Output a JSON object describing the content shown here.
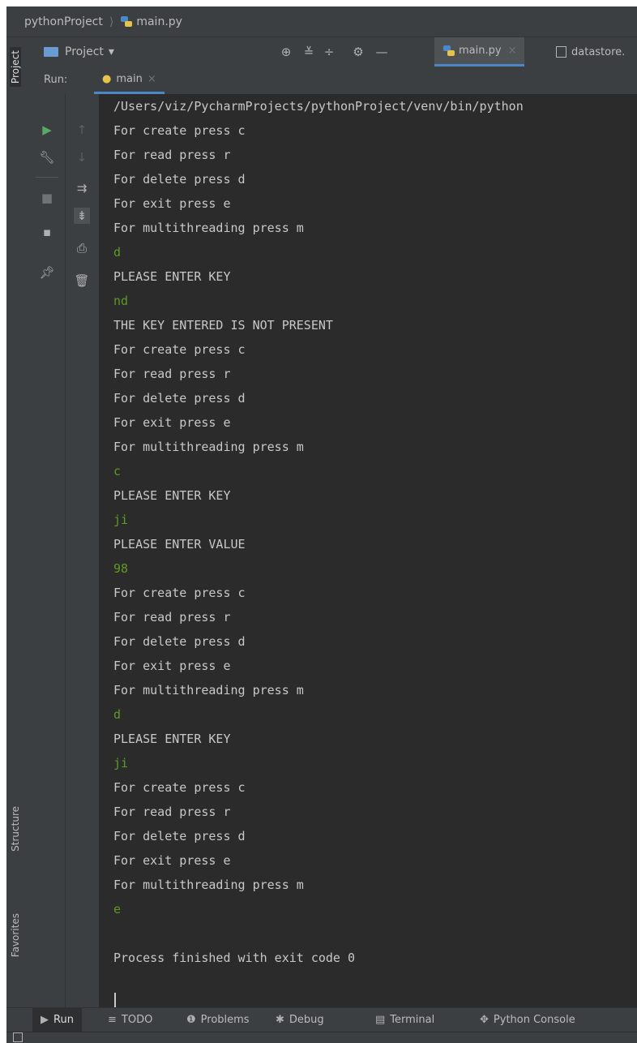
{
  "breadcrumb": {
    "project": "pythonProject",
    "file": "main.py"
  },
  "project_bar": {
    "label": "Project",
    "dropdown_glyph": "▾",
    "icons": [
      "target-icon",
      "collapse-all-icon",
      "expand-icon",
      "gear-icon",
      "minimize-icon"
    ]
  },
  "editor_tabs": [
    {
      "label": "main.py",
      "active": true
    },
    {
      "label": "datastore."
    }
  ],
  "run_panel": {
    "label": "Run:",
    "tab_label": "main"
  },
  "left_strip": {
    "project_label": "Project",
    "structure_label": "Structure",
    "favorites_label": "Favorites"
  },
  "console_lines": [
    {
      "text": "/Users/viz/PycharmProjects/pythonProject/venv/bin/python",
      "type": "output"
    },
    {
      "text": "For create press c",
      "type": "output"
    },
    {
      "text": "For read press r",
      "type": "output"
    },
    {
      "text": "For delete press d",
      "type": "output"
    },
    {
      "text": "For exit press e",
      "type": "output"
    },
    {
      "text": "For multithreading press m",
      "type": "output"
    },
    {
      "text": "d",
      "type": "input"
    },
    {
      "text": "PLEASE ENTER KEY",
      "type": "output"
    },
    {
      "text": "nd",
      "type": "input"
    },
    {
      "text": "THE KEY ENTERED IS NOT PRESENT",
      "type": "output"
    },
    {
      "text": "For create press c",
      "type": "output"
    },
    {
      "text": "For read press r",
      "type": "output"
    },
    {
      "text": "For delete press d",
      "type": "output"
    },
    {
      "text": "For exit press e",
      "type": "output"
    },
    {
      "text": "For multithreading press m",
      "type": "output"
    },
    {
      "text": "c",
      "type": "input"
    },
    {
      "text": "PLEASE ENTER KEY",
      "type": "output"
    },
    {
      "text": "ji",
      "type": "input"
    },
    {
      "text": "PLEASE ENTER VALUE",
      "type": "output"
    },
    {
      "text": "98",
      "type": "input"
    },
    {
      "text": "For create press c",
      "type": "output"
    },
    {
      "text": "For read press r",
      "type": "output"
    },
    {
      "text": "For delete press d",
      "type": "output"
    },
    {
      "text": "For exit press e",
      "type": "output"
    },
    {
      "text": "For multithreading press m",
      "type": "output"
    },
    {
      "text": "d",
      "type": "input"
    },
    {
      "text": "PLEASE ENTER KEY",
      "type": "output"
    },
    {
      "text": "ji",
      "type": "input"
    },
    {
      "text": "For create press c",
      "type": "output"
    },
    {
      "text": "For read press r",
      "type": "output"
    },
    {
      "text": "For delete press d",
      "type": "output"
    },
    {
      "text": "For exit press e",
      "type": "output"
    },
    {
      "text": "For multithreading press m",
      "type": "output"
    },
    {
      "text": "e",
      "type": "input"
    },
    {
      "text": "",
      "type": "output"
    },
    {
      "text": "Process finished with exit code 0",
      "type": "output"
    }
  ],
  "bottom_tabs": {
    "run": "Run",
    "todo": "TODO",
    "problems": "Problems",
    "debug": "Debug",
    "terminal": "Terminal",
    "python_console": "Python Console"
  },
  "colors": {
    "console_bg": "#2b2b2b",
    "input_text": "#5d9a27",
    "output_text": "#c8c8c8",
    "panel_bg": "#3c3f41",
    "accent": "#4a88c7"
  }
}
